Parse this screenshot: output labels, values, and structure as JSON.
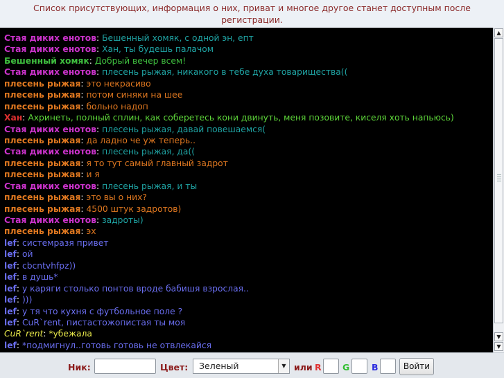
{
  "notice": "Список присутствующих, информация о них, приват и многое другое станет доступным после регистрации.",
  "messages": [
    {
      "nick": "Стая диких енотов",
      "text": "Бешенный хомяк, с одной эн, епт",
      "nick_color": "#cc33cc",
      "text_color": "#1fa3a3"
    },
    {
      "nick": "Стая диких енотов",
      "text": "Хан, ты будешь палачом",
      "nick_color": "#cc33cc",
      "text_color": "#1fa3a3"
    },
    {
      "nick": "Бешенный хомяк",
      "text": "Добрый вечер всем!",
      "nick_color": "#3fbf3f",
      "text_color": "#3fbf3f"
    },
    {
      "nick": "Стая диких енотов",
      "text": "плесень рыжая, никакого в тебе духа товарищества((",
      "nick_color": "#cc33cc",
      "text_color": "#1fa3a3"
    },
    {
      "nick": "плесень рыжая",
      "text": "это некрасиво",
      "nick_color": "#e07820",
      "text_color": "#e07820"
    },
    {
      "nick": "плесень рыжая",
      "text": "потом синяки на шее",
      "nick_color": "#e07820",
      "text_color": "#e07820"
    },
    {
      "nick": "плесень рыжая",
      "text": "больно надоп",
      "nick_color": "#e07820",
      "text_color": "#e07820"
    },
    {
      "nick": "Хан",
      "text": "Ахринеть, полный сплин, как соберетесь кони двинуть, меня позовите, киселя хоть напьюсь)",
      "nick_color": "#e03030",
      "text_color": "#5ed63a"
    },
    {
      "nick": "Стая диких енотов",
      "text": "плесень рыжая, давай повешаемся(",
      "nick_color": "#cc33cc",
      "text_color": "#1fa3a3"
    },
    {
      "nick": "плесень рыжая",
      "text": "да ладно че уж теперь..",
      "nick_color": "#e07820",
      "text_color": "#e07820"
    },
    {
      "nick": "Стая диких енотов",
      "text": "плесень рыжая, да((",
      "nick_color": "#cc33cc",
      "text_color": "#1fa3a3"
    },
    {
      "nick": "плесень рыжая",
      "text": "я то тут самый главный задрот",
      "nick_color": "#e07820",
      "text_color": "#e07820"
    },
    {
      "nick": "плесень рыжая",
      "text": "и я",
      "nick_color": "#e07820",
      "text_color": "#e07820"
    },
    {
      "nick": "Стая диких енотов",
      "text": "плесень рыжая, и ты",
      "nick_color": "#cc33cc",
      "text_color": "#1fa3a3"
    },
    {
      "nick": "плесень рыжая",
      "text": "это вы о них?",
      "nick_color": "#e07820",
      "text_color": "#e07820"
    },
    {
      "nick": "плесень рыжая",
      "text": "4500 штук задротов)",
      "nick_color": "#e07820",
      "text_color": "#e07820"
    },
    {
      "nick": "Стая диких енотов",
      "text": "задроты)",
      "nick_color": "#cc33cc",
      "text_color": "#1fa3a3"
    },
    {
      "nick": "плесень рыжая",
      "text": "эх",
      "nick_color": "#e07820",
      "text_color": "#e07820"
    },
    {
      "nick": "lef",
      "text": "системразя привет",
      "nick_color": "#6a6ef0",
      "text_color": "#6a6ef0"
    },
    {
      "nick": "lef",
      "text": "ой",
      "nick_color": "#6a6ef0",
      "text_color": "#6a6ef0"
    },
    {
      "nick": "lef",
      "text": "cbcntvhfpz))",
      "nick_color": "#6a6ef0",
      "text_color": "#6a6ef0"
    },
    {
      "nick": "lef",
      "text": "в душь*",
      "nick_color": "#6a6ef0",
      "text_color": "#6a6ef0"
    },
    {
      "nick": "lef",
      "text": "у каряги столько понтов вроде бабишя взрослая..",
      "nick_color": "#6a6ef0",
      "text_color": "#6a6ef0"
    },
    {
      "nick": "lef",
      "text": ")))",
      "nick_color": "#6a6ef0",
      "text_color": "#6a6ef0"
    },
    {
      "nick": "lef",
      "text": "у тя что кухня с футбольное поле ?",
      "nick_color": "#6a6ef0",
      "text_color": "#6a6ef0"
    },
    {
      "nick": "lef",
      "text": "CuR`rent, пистастожопистая ты моя",
      "nick_color": "#6a6ef0",
      "text_color": "#6a6ef0"
    },
    {
      "nick": "CuR`rent",
      "text": "*убежала",
      "nick_color": "#e6e64a",
      "text_color": "#e6e64a",
      "italic": true
    },
    {
      "nick": "lef",
      "text": "*подмигнул..готовь готовь не отвлекайся",
      "nick_color": "#6a6ef0",
      "text_color": "#6a6ef0"
    }
  ],
  "form": {
    "nick_label": "Ник:",
    "nick_value": "",
    "color_label": "Цвет:",
    "color_value": "Зеленый",
    "or_label": "или",
    "r_label": "R",
    "g_label": "G",
    "b_label": "B",
    "r_color": "#e03030",
    "g_color": "#2fbf2f",
    "b_color": "#2a2adf",
    "submit_label": "Войти"
  }
}
